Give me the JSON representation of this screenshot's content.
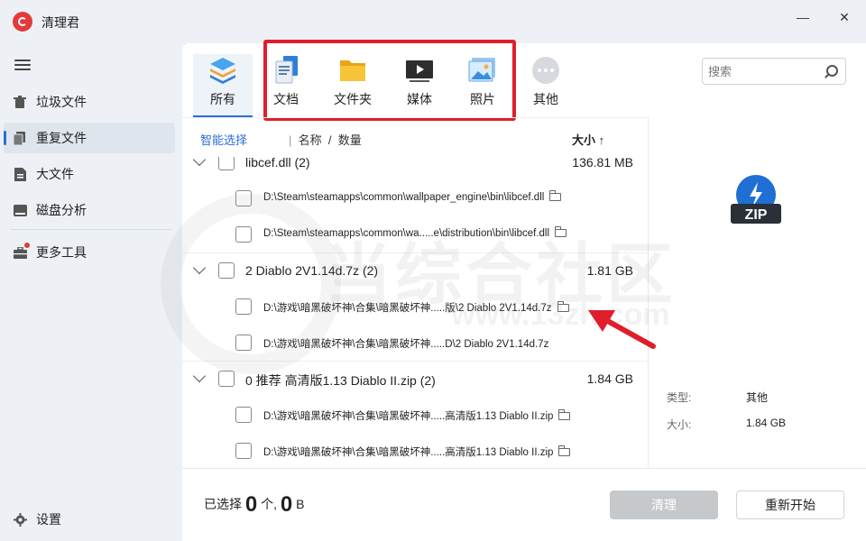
{
  "app": {
    "title": "清理君"
  },
  "window": {
    "minimize": "—",
    "close": "✕"
  },
  "sidebar": {
    "items": [
      {
        "label": "垃圾文件",
        "icon": "trash-icon"
      },
      {
        "label": "重复文件",
        "icon": "duplicate-icon",
        "active": true
      },
      {
        "label": "大文件",
        "icon": "large-file-icon"
      },
      {
        "label": "磁盘分析",
        "icon": "disk-icon"
      },
      {
        "label": "更多工具",
        "icon": "toolbox-icon",
        "badge": true
      }
    ],
    "settings_label": "设置"
  },
  "categories": [
    {
      "label": "所有",
      "icon": "stack-icon",
      "selected": true
    },
    {
      "label": "文档",
      "icon": "document-icon"
    },
    {
      "label": "文件夹",
      "icon": "folder-icon"
    },
    {
      "label": "媒体",
      "icon": "media-icon"
    },
    {
      "label": "照片",
      "icon": "photo-icon"
    },
    {
      "label": "其他",
      "icon": "more-icon"
    }
  ],
  "search": {
    "placeholder": "搜索"
  },
  "list_header": {
    "smart_select": "智能选择",
    "sort_name": "名称",
    "sort_separator": "/",
    "sort_count": "数量",
    "size_label": "大小",
    "size_sort": "↑"
  },
  "groups": [
    {
      "name": "libcef.dll (2)",
      "size": "136.81 MB",
      "files": [
        "D:\\Steam\\steamapps\\common\\wallpaper_engine\\bin\\libcef.dll",
        "D:\\Steam\\steamapps\\common\\wa.....e\\distribution\\bin\\libcef.dll"
      ]
    },
    {
      "name": "2 Diablo 2V1.14d.7z (2)",
      "size": "1.81 GB",
      "files": [
        "D:\\游戏\\暗黑破坏神\\合集\\暗黑破坏神.....版\\2 Diablo 2V1.14d.7z",
        "D:\\游戏\\暗黑破坏神\\合集\\暗黑破坏神.....D\\2 Diablo 2V1.14d.7z"
      ]
    },
    {
      "name": "0 推荐 高清版1.13 Diablo II.zip (2)",
      "size": "1.84 GB",
      "files": [
        "D:\\游戏\\暗黑破坏神\\合集\\暗黑破坏神.....高清版1.13 Diablo II.zip",
        "D:\\游戏\\暗黑破坏神\\合集\\暗黑破坏神.....高清版1.13 Diablo II.zip"
      ]
    }
  ],
  "preview": {
    "icon": "zip-file-icon",
    "icon_text": "ZIP",
    "type_label": "类型:",
    "type_value": "其他",
    "size_label": "大小:",
    "size_value": "1.84 GB"
  },
  "bottom": {
    "selected_prefix": "已选择",
    "selected_count": "0",
    "count_unit": "个,",
    "selected_size": "0",
    "size_unit": "B",
    "clean_button": "清理",
    "restart_button": "重新开始"
  },
  "watermark": {
    "text": "当综合社区",
    "url": "www.13zh.com"
  },
  "colors": {
    "accent": "#2b6fd6",
    "highlight": "#e01e2b",
    "disabled_button": "#c6c9cc",
    "sidebar_bg": "#edf1f5"
  }
}
